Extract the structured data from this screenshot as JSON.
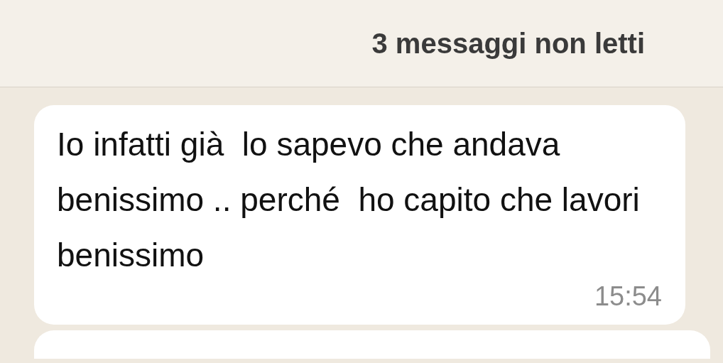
{
  "unread_banner": {
    "text": "3 messaggi non letti"
  },
  "messages": [
    {
      "text": "Io infatti già  lo sapevo che andava benissimo .. perché  ho capito che lavori benissimo",
      "time": "15:54"
    }
  ],
  "next_message": {
    "kind": "bubble"
  }
}
